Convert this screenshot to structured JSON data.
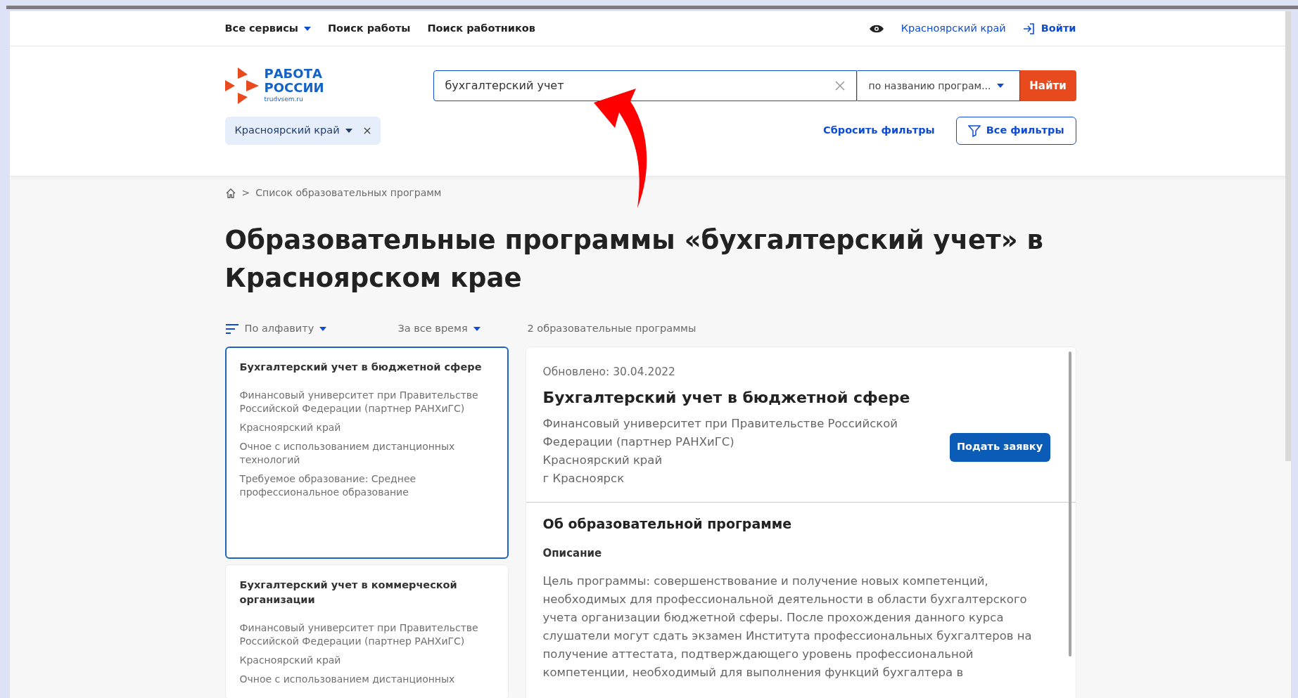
{
  "top_nav": {
    "items": [
      {
        "label": "Все сервисы",
        "dropdown": true
      },
      {
        "label": "Поиск работы",
        "dropdown": false
      },
      {
        "label": "Поиск работников",
        "dropdown": false
      }
    ],
    "region": "Красноярский край",
    "login": "Войти"
  },
  "logo": {
    "lines": [
      "РАБОТА",
      "РОССИИ"
    ],
    "site": "trudvsem.ru"
  },
  "search": {
    "value": "бухгалтерский учет",
    "mode": "по названию програм...",
    "button": "Найти"
  },
  "filters": {
    "chips": [
      {
        "label": "Красноярский край"
      }
    ],
    "reset": "Сбросить фильтры",
    "all": "Все фильтры"
  },
  "breadcrumb": {
    "separator": ">",
    "items": [
      "Список образовательных программ"
    ]
  },
  "heading": "Образовательные программы «бухгалтерский учет» в Красноярском крае",
  "sort": {
    "label": "По алфавиту",
    "period": "За все время",
    "count": "2 образовательные программы"
  },
  "programs": [
    {
      "title": "Бухгалтерский учет в бюджетной сфере",
      "org": "Финансовый университет при Правительстве Российской Федерации (партнер РАНХиГС)",
      "region": "Красноярский край",
      "form": "Очное с использованием дистанционных технологий",
      "education": "Требуемое образование: Среднее профессиональное образование",
      "selected": true
    },
    {
      "title": "Бухгалтерский учет в коммерческой организации",
      "org": "Финансовый университет при Правительстве Российской Федерации (партнер РАНХиГС)",
      "region": "Красноярский край",
      "form": "Очное с использованием дистанционных",
      "selected": false
    }
  ],
  "detail": {
    "updated": "Обновлено: 30.04.2022",
    "title": "Бухгалтерский учет в бюджетной сфере",
    "info": [
      "Финансовый университет при Правительстве Российской Федерации (партнер РАНХиГС)",
      "Красноярский край",
      "г Красноярск"
    ],
    "apply": "Подать заявку",
    "section": "Об образовательной программе",
    "subsection": "Описание",
    "description": "Цель программы: совершенствование и получение новых компетенций, необходимых для профессиональной деятельности в области бухгалтерского учета организации бюджетной сферы. После прохождения данного курса слушатели могут сдать экзамен Института профессиональных бухгалтеров на получение аттестата, подтверждающего уровень профессиональной компетенции, необходимый для выполнения функций бухгалтера в"
  }
}
